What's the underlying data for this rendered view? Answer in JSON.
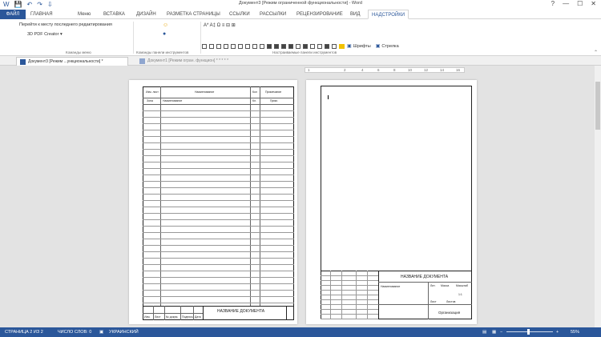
{
  "window": {
    "title": "Документ3 [Режим ограниченной функциональности] - Word",
    "qat": [
      "W",
      "💾",
      "↶",
      "↷",
      "⇩"
    ],
    "controls": [
      "?",
      "—",
      "☐",
      "✕"
    ]
  },
  "tabs": [
    {
      "label": "ФАЙЛ"
    },
    {
      "label": "ГЛАВНАЯ"
    },
    {
      "label": "Меню"
    },
    {
      "label": "ВСТАВКА"
    },
    {
      "label": "ДИЗАЙН"
    },
    {
      "label": "РАЗМЕТКА СТРАНИЦЫ"
    },
    {
      "label": "ССЫЛКИ"
    },
    {
      "label": "РАССЫЛКИ"
    },
    {
      "label": "РЕЦЕНЗИРОВАНИЕ"
    },
    {
      "label": "ВИД"
    },
    {
      "label": "НАДСТРОЙКИ"
    }
  ],
  "ribbon": {
    "goto_last": "Перейти к месту последнего редактирования",
    "pdf_creator": "3D PDF Creator ▾",
    "fonts_label": "Шрифты",
    "refresh_label": "Стрелка",
    "symbols": "A* A‡ Ω ≡ ⊟ ⊞",
    "group_menu": "Команды меню",
    "group_toolbar": "Команды панели инструментов",
    "group_custom": "Настраиваемые панели инструментов"
  },
  "doc_tabs": [
    {
      "label": "Документ3 [Режим ...ункциональности] *"
    },
    {
      "label": "Документ1 [Режим огран. функцион] * * * * *"
    }
  ],
  "ruler": [
    "1",
    "2",
    "4",
    "6",
    "8",
    "10",
    "12",
    "14",
    "16"
  ],
  "page1": {
    "header_cols": [
      "Изм. лист",
      "Наименование",
      "Кол",
      "Примечание"
    ],
    "subheader": [
      "Зона",
      "Наименование",
      "Кл.",
      "Прим."
    ],
    "stamp_title": "НАЗВАНИЕ ДОКУМЕНТА",
    "stamp_bottom": [
      "Изм.",
      "Лист",
      "№ докум.",
      "Подпись",
      "Дата"
    ]
  },
  "page2": {
    "stamp_title": "НАЗВАНИЕ ДОКУМЕНТА",
    "stamp_sub": "Наименование",
    "stamp_cols": [
      "Лит.",
      "Масса",
      "Масштаб"
    ],
    "stamp_scale": "1:1",
    "org": "Организация",
    "sheet": "Лист",
    "sheets": "Листов"
  },
  "status": {
    "page": "СТРАНИЦА 2 ИЗ 2",
    "words": "ЧИСЛО СЛОВ: 0",
    "lang": "УКРАИНСКИЙ",
    "zoom": "55%"
  }
}
